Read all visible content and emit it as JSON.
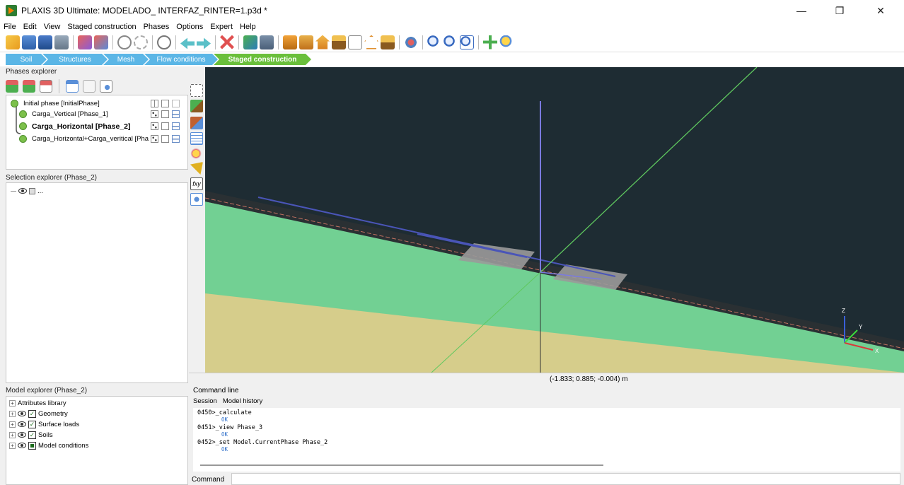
{
  "window": {
    "title": "PLAXIS 3D Ultimate: MODELADO_ INTERFAZ_RINTER=1.p3d *"
  },
  "menu": [
    "File",
    "Edit",
    "View",
    "Staged construction",
    "Phases",
    "Options",
    "Expert",
    "Help"
  ],
  "modes": [
    "Soil",
    "Structures",
    "Mesh",
    "Flow conditions",
    "Staged construction"
  ],
  "active_mode": "Staged construction",
  "phases_explorer": {
    "title": "Phases explorer",
    "phases": [
      {
        "label": "Initial phase [InitialPhase]",
        "bold": false
      },
      {
        "label": "Carga_Vertical [Phase_1]",
        "bold": false
      },
      {
        "label": "Carga_Horizontal [Phase_2]",
        "bold": true
      },
      {
        "label": "Carga_Horizontal+Carga_veritical [Pha",
        "bold": false
      }
    ]
  },
  "selection_explorer": {
    "title": "Selection explorer (Phase_2)",
    "item": "..."
  },
  "model_explorer": {
    "title": "Model explorer (Phase_2)",
    "items": [
      "Attributes library",
      "Geometry",
      "Surface loads",
      "Soils",
      "Model conditions"
    ]
  },
  "viewport": {
    "coordinates": "(-1.833; 0.885; -0.004) m",
    "axis_labels": {
      "z": "Z",
      "y": "Y",
      "x": "X"
    },
    "colors": {
      "sky": "#1e2c33",
      "soil_green": "#72d093",
      "soil_tan": "#d6cd8b",
      "surface": "#2a3033"
    }
  },
  "command_line": {
    "title": "Command line",
    "tabs": [
      "Session",
      "Model history"
    ],
    "log": [
      {
        "num": "0450>",
        "cmd": "_calculate",
        "result": "OK"
      },
      {
        "num": "0451>",
        "cmd": "_view Phase_3",
        "result": "OK"
      },
      {
        "num": "0452>",
        "cmd": "_set Model.CurrentPhase Phase_2",
        "result": "OK"
      }
    ],
    "input_label": "Command"
  }
}
